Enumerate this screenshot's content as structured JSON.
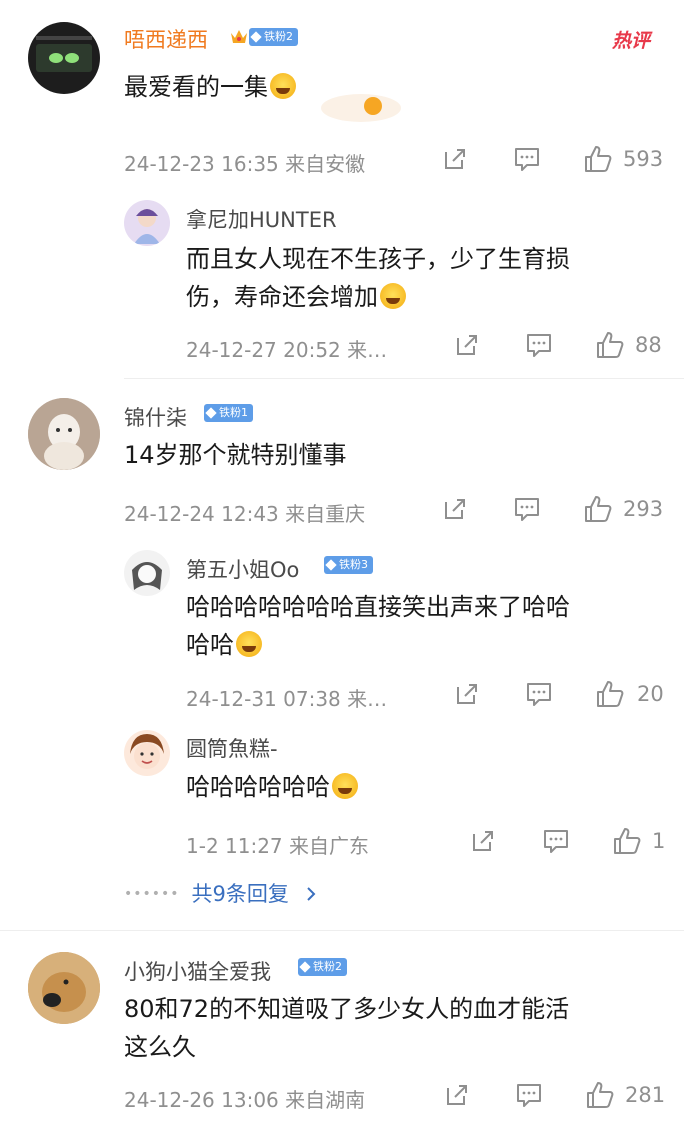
{
  "hot_label": "热评",
  "comments": [
    {
      "user": "唔西递西",
      "badge": "铁粉2",
      "text": "最爱看的一集",
      "meta": "24-12-23 16:35 来自安徽",
      "likes": "593"
    },
    {
      "user": "拿尼加HUNTER",
      "text_line1": "而且女人现在不生孩子，少了生育损",
      "text_line2": "伤，寿命还会增加",
      "meta": "24-12-27 20:52 来…",
      "likes": "88"
    },
    {
      "user": "锦什柒",
      "badge": "铁粉1",
      "text": "14岁那个就特别懂事",
      "meta": "24-12-24 12:43 来自重庆",
      "likes": "293"
    },
    {
      "user": "第五小姐Oo",
      "badge": "铁粉3",
      "text_line1": "哈哈哈哈哈哈哈直接笑出声来了哈哈",
      "text_line2": "哈哈",
      "meta": "24-12-31 07:38 来…",
      "likes": "20"
    },
    {
      "user": "圆筒魚糕-",
      "text": "哈哈哈哈哈哈",
      "meta": "1-2 11:27 来自广东",
      "likes": "1"
    },
    {
      "user": "小狗小猫全爱我",
      "badge": "铁粉2",
      "text_line1": "80和72的不知道吸了多少女人的血才能活",
      "text_line2": "这么久",
      "meta": "24-12-26 13:06 来自湖南",
      "likes": "281"
    }
  ],
  "more_replies": "共9条回复",
  "colors": {
    "username_highlight": "#f07a1f",
    "link": "#3a6fbf",
    "badge": "#5e9de8",
    "hot": "#e8394a"
  },
  "icons": [
    "share-icon",
    "comment-icon",
    "like-icon",
    "crown-icon",
    "chevron-right-icon"
  ]
}
